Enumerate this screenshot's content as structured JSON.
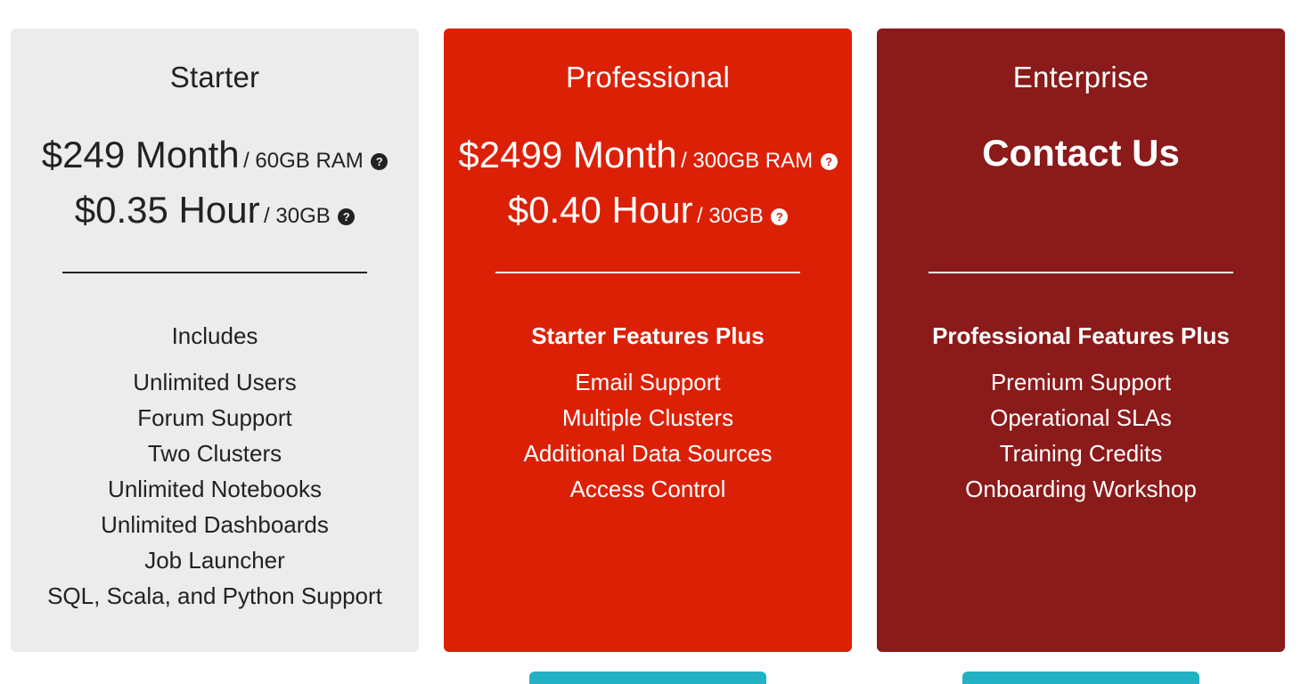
{
  "plans": {
    "starter": {
      "title": "Starter",
      "monthly_price": "$249 Month",
      "monthly_detail": "/ 60GB RAM",
      "hourly_price": "$0.35 Hour",
      "hourly_detail": "/ 30GB",
      "features_heading": "Includes",
      "features": [
        "Unlimited Users",
        "Forum Support",
        "Two Clusters",
        "Unlimited Notebooks",
        "Unlimited Dashboards",
        "Job Launcher",
        "SQL, Scala, and Python Support"
      ],
      "color": "#ececec"
    },
    "professional": {
      "title": "Professional",
      "monthly_price": "$2499 Month",
      "monthly_detail": "/ 300GB RAM",
      "hourly_price": "$0.40 Hour",
      "hourly_detail": "/ 30GB",
      "features_heading": "Starter Features Plus",
      "features": [
        "Email Support",
        "Multiple Clusters",
        "Additional Data Sources",
        "Access Control"
      ],
      "color": "#dc2006"
    },
    "enterprise": {
      "title": "Enterprise",
      "contact": "Contact Us",
      "features_heading": "Professional Features Plus",
      "features": [
        "Premium Support",
        "Operational SLAs",
        "Training Credits",
        "Onboarding Workshop"
      ],
      "color": "#8b1a1a"
    }
  },
  "icons": {
    "help": "?"
  },
  "button_color": "#22b2c4"
}
